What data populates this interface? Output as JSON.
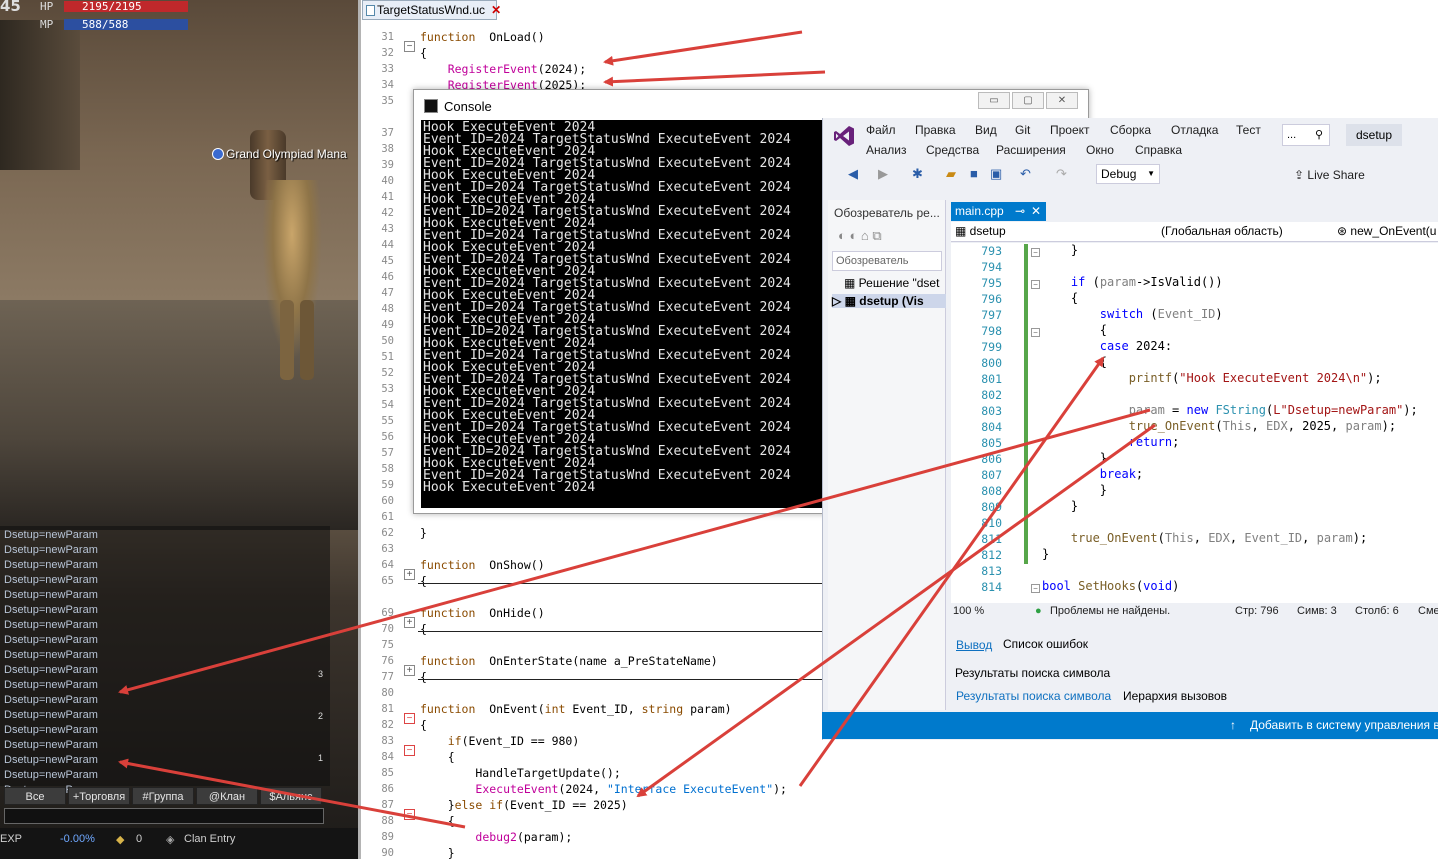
{
  "game": {
    "level": "45",
    "hp": {
      "label": "HP",
      "value": "2195/2195",
      "fill": 1.0,
      "color": "#c0282b"
    },
    "mp": {
      "label": "MP",
      "value": "588/588",
      "fill": 1.0,
      "color": "#2c4fa0"
    },
    "npc_label": "Grand Olympiad Mana",
    "chat_lines": [
      "Dsetup=newParam",
      "Dsetup=newParam",
      "Dsetup=newParam",
      "Dsetup=newParam",
      "Dsetup=newParam",
      "Dsetup=newParam",
      "Dsetup=newParam",
      "Dsetup=newParam",
      "Dsetup=newParam",
      "Dsetup=newParam",
      "Dsetup=newParam",
      "Dsetup=newParam",
      "Dsetup=newParam",
      "Dsetup=newParam",
      "Dsetup=newParam",
      "Dsetup=newParam",
      "Dsetup=newParam",
      "Dsetup=newParam"
    ],
    "chat_scroll": [
      "3",
      "2",
      "1"
    ],
    "chat_tabs": [
      "Все",
      "+Торговля",
      "#Группа",
      "@Клан",
      "$Альянс"
    ],
    "status": {
      "exp_label": "EXP",
      "exp_value": "-0.00%",
      "adena": "0",
      "clan": "Clan Entry"
    }
  },
  "editor": {
    "tab": "TargetStatusWnd.uc",
    "lines": [
      {
        "n": "31",
        "code": [
          [
            "kw",
            "function"
          ],
          [
            "",
            "  OnLoad()"
          ]
        ]
      },
      {
        "n": "32",
        "code": [
          [
            "",
            "{"
          ]
        ]
      },
      {
        "n": "33",
        "code": [
          [
            "",
            "    "
          ],
          [
            "pk",
            "RegisterEvent"
          ],
          [
            "",
            "(2024);"
          ]
        ]
      },
      {
        "n": "34",
        "code": [
          [
            "",
            "    "
          ],
          [
            "pk",
            "RegisterEvent"
          ],
          [
            "",
            "(2025);"
          ]
        ]
      },
      {
        "n": "35",
        "code": []
      },
      {
        "n": "37",
        "code": []
      },
      {
        "n": "38",
        "code": []
      },
      {
        "n": "39",
        "code": []
      },
      {
        "n": "40",
        "code": []
      },
      {
        "n": "41",
        "code": []
      },
      {
        "n": "42",
        "code": []
      },
      {
        "n": "43",
        "code": []
      },
      {
        "n": "44",
        "code": []
      },
      {
        "n": "45",
        "code": []
      },
      {
        "n": "46",
        "code": []
      },
      {
        "n": "47",
        "code": []
      },
      {
        "n": "48",
        "code": []
      },
      {
        "n": "49",
        "code": []
      },
      {
        "n": "50",
        "code": []
      },
      {
        "n": "51",
        "code": []
      },
      {
        "n": "52",
        "code": []
      },
      {
        "n": "53",
        "code": []
      },
      {
        "n": "54",
        "code": []
      },
      {
        "n": "55",
        "code": []
      },
      {
        "n": "56",
        "code": []
      },
      {
        "n": "57",
        "code": []
      },
      {
        "n": "58",
        "code": []
      },
      {
        "n": "59",
        "code": []
      },
      {
        "n": "60",
        "code": []
      },
      {
        "n": "61",
        "code": []
      },
      {
        "n": "62",
        "code": [
          [
            "",
            "}"
          ]
        ]
      },
      {
        "n": "63",
        "code": []
      },
      {
        "n": "64",
        "code": [
          [
            "kw",
            "function"
          ],
          [
            "",
            "  OnShow()"
          ]
        ]
      },
      {
        "n": "65",
        "code": [
          [
            "",
            "{"
          ]
        ]
      },
      {
        "n": "69",
        "code": [
          [
            "kw",
            "function"
          ],
          [
            "",
            "  OnHide()"
          ]
        ]
      },
      {
        "n": "70",
        "code": [
          [
            "",
            "{"
          ]
        ]
      },
      {
        "n": "75",
        "code": []
      },
      {
        "n": "76",
        "code": [
          [
            "kw",
            "function"
          ],
          [
            "",
            "  OnEnterState(name a_PreStateName)"
          ]
        ]
      },
      {
        "n": "77",
        "code": [
          [
            "",
            "{"
          ]
        ]
      },
      {
        "n": "80",
        "code": []
      },
      {
        "n": "81",
        "code": [
          [
            "kw",
            "function"
          ],
          [
            "",
            "  OnEvent("
          ],
          [
            "kw",
            "int"
          ],
          [
            "",
            " Event_ID, "
          ],
          [
            "kw",
            "string"
          ],
          [
            "",
            " param)"
          ]
        ]
      },
      {
        "n": "82",
        "code": [
          [
            "",
            "{"
          ]
        ]
      },
      {
        "n": "83",
        "code": [
          [
            "",
            "    "
          ],
          [
            "kw",
            "if"
          ],
          [
            "",
            "(Event_ID == 980)"
          ]
        ]
      },
      {
        "n": "84",
        "code": [
          [
            "",
            "    {"
          ]
        ]
      },
      {
        "n": "85",
        "code": [
          [
            "",
            "        HandleTargetUpdate();"
          ]
        ]
      },
      {
        "n": "86",
        "code": [
          [
            "",
            "        "
          ],
          [
            "pk",
            "ExecuteEvent"
          ],
          [
            "",
            "(2024, "
          ],
          [
            "str",
            "\"Interface ExecuteEvent\""
          ],
          [
            "",
            ");"
          ]
        ]
      },
      {
        "n": "87",
        "code": [
          [
            "",
            "    }"
          ],
          [
            "kw",
            "else if"
          ],
          [
            "",
            "(Event_ID == 2025)"
          ]
        ]
      },
      {
        "n": "88",
        "code": [
          [
            "",
            "    {"
          ]
        ]
      },
      {
        "n": "89",
        "code": [
          [
            "",
            "        "
          ],
          [
            "pk",
            "debug2"
          ],
          [
            "",
            "(param);"
          ]
        ]
      },
      {
        "n": "90",
        "code": [
          [
            "",
            "    }"
          ]
        ]
      }
    ]
  },
  "console": {
    "title": "Console",
    "lines": [
      "Hook ExecuteEvent 2024",
      "Event_ID=2024 TargetStatusWnd ExecuteEvent 2024",
      "Hook ExecuteEvent 2024",
      "Event_ID=2024 TargetStatusWnd ExecuteEvent 2024",
      "Hook ExecuteEvent 2024",
      "Event_ID=2024 TargetStatusWnd ExecuteEvent 2024",
      "Hook ExecuteEvent 2024",
      "Event_ID=2024 TargetStatusWnd ExecuteEvent 2024",
      "Hook ExecuteEvent 2024",
      "Event_ID=2024 TargetStatusWnd ExecuteEvent 2024",
      "Hook ExecuteEvent 2024",
      "Event_ID=2024 TargetStatusWnd ExecuteEvent 2024",
      "Hook ExecuteEvent 2024",
      "Event_ID=2024 TargetStatusWnd ExecuteEvent 2024",
      "Hook ExecuteEvent 2024",
      "Event_ID=2024 TargetStatusWnd ExecuteEvent 2024",
      "Hook ExecuteEvent 2024",
      "Event_ID=2024 TargetStatusWnd ExecuteEvent 2024",
      "Hook ExecuteEvent 2024",
      "Event_ID=2024 TargetStatusWnd ExecuteEvent 2024",
      "Hook ExecuteEvent 2024",
      "Event_ID=2024 TargetStatusWnd ExecuteEvent 2024",
      "Hook ExecuteEvent 2024",
      "Event_ID=2024 TargetStatusWnd ExecuteEvent 2024",
      "Hook ExecuteEvent 2024",
      "Event_ID=2024 TargetStatusWnd ExecuteEvent 2024",
      "Hook ExecuteEvent 2024",
      "Event_ID=2024 TargetStatusWnd ExecuteEvent 2024",
      "Hook ExecuteEvent 2024",
      "Event_ID=2024 TargetStatusWnd ExecuteEvent 2024",
      "Hook ExecuteEvent 2024"
    ]
  },
  "vs": {
    "menu_row1": [
      "Файл",
      "Правка",
      "Вид",
      "Git",
      "Проект",
      "Сборка",
      "Отладка",
      "Тест"
    ],
    "menu_row2": [
      "Анализ",
      "Средства",
      "Расширения",
      "Окно",
      "Справка"
    ],
    "search": "...",
    "solution_name": "dsetup",
    "config": "Debug",
    "live_share": "Live Share",
    "solution_panel": {
      "header": "Обозреватель ре...",
      "search": "Обозреватель",
      "item1": "Решение \"dset",
      "item2": "dsetup (Vis"
    },
    "file_tab": "main.cpp",
    "nav": {
      "project": "dsetup",
      "scope": "(Глобальная область)",
      "member": "new_OnEvent(u"
    },
    "code": [
      {
        "n": "793",
        "t": [
          [
            "",
            "    }"
          ]
        ]
      },
      {
        "n": "794",
        "t": []
      },
      {
        "n": "795",
        "t": [
          [
            "",
            "    "
          ],
          [
            "vk",
            "if"
          ],
          [
            "",
            " ("
          ],
          [
            "vp",
            "param"
          ],
          [
            "",
            "->IsValid())"
          ]
        ]
      },
      {
        "n": "796",
        "t": [
          [
            "",
            "    {"
          ]
        ]
      },
      {
        "n": "797",
        "t": [
          [
            "",
            "        "
          ],
          [
            "vk",
            "switch"
          ],
          [
            "",
            " ("
          ],
          [
            "vp",
            "Event_ID"
          ],
          [
            "",
            ")"
          ]
        ]
      },
      {
        "n": "798",
        "t": [
          [
            "",
            "        {"
          ]
        ]
      },
      {
        "n": "799",
        "t": [
          [
            "",
            "        "
          ],
          [
            "vk",
            "case"
          ],
          [
            "",
            " 2024:"
          ]
        ]
      },
      {
        "n": "800",
        "t": [
          [
            "",
            "        {"
          ]
        ]
      },
      {
        "n": "801",
        "t": [
          [
            "",
            "            "
          ],
          [
            "vf",
            "printf"
          ],
          [
            "",
            "("
          ],
          [
            "vs",
            "\"Hook ExecuteEvent 2024\\n\""
          ],
          [
            "",
            ");"
          ]
        ]
      },
      {
        "n": "802",
        "t": []
      },
      {
        "n": "803",
        "t": [
          [
            "",
            "            "
          ],
          [
            "vp",
            "param"
          ],
          [
            "",
            " = "
          ],
          [
            "vk",
            "new"
          ],
          [
            "",
            " "
          ],
          [
            "vt",
            "FString"
          ],
          [
            "",
            "("
          ],
          [
            "vs",
            "L\"Dsetup=newParam\""
          ],
          [
            "",
            ");"
          ]
        ]
      },
      {
        "n": "804",
        "t": [
          [
            "",
            "            "
          ],
          [
            "vf",
            "true_OnEvent"
          ],
          [
            "",
            "("
          ],
          [
            "vp",
            "This"
          ],
          [
            "",
            ", "
          ],
          [
            "vp",
            "EDX"
          ],
          [
            "",
            ", 2025, "
          ],
          [
            "vp",
            "param"
          ],
          [
            "",
            ");"
          ]
        ]
      },
      {
        "n": "805",
        "t": [
          [
            "",
            "            "
          ],
          [
            "vk",
            "return"
          ],
          [
            "",
            ";"
          ]
        ]
      },
      {
        "n": "806",
        "t": [
          [
            "",
            "        }"
          ]
        ]
      },
      {
        "n": "807",
        "t": [
          [
            "",
            "        "
          ],
          [
            "vk",
            "break"
          ],
          [
            "",
            ";"
          ]
        ]
      },
      {
        "n": "808",
        "t": [
          [
            "",
            "        }"
          ]
        ]
      },
      {
        "n": "809",
        "t": [
          [
            "",
            "    }"
          ]
        ]
      },
      {
        "n": "810",
        "t": []
      },
      {
        "n": "811",
        "t": [
          [
            "",
            "    "
          ],
          [
            "vf",
            "true_OnEvent"
          ],
          [
            "",
            "("
          ],
          [
            "vp",
            "This"
          ],
          [
            "",
            ", "
          ],
          [
            "vp",
            "EDX"
          ],
          [
            "",
            ", "
          ],
          [
            "vp",
            "Event_ID"
          ],
          [
            "",
            ", "
          ],
          [
            "vp",
            "param"
          ],
          [
            "",
            ");"
          ]
        ]
      },
      {
        "n": "812",
        "t": [
          [
            "",
            "}"
          ]
        ]
      },
      {
        "n": "813",
        "t": []
      },
      {
        "n": "814",
        "t": [
          [
            "vk",
            "bool"
          ],
          [
            "",
            " "
          ],
          [
            "vf",
            "SetHooks"
          ],
          [
            "",
            "("
          ],
          [
            "vk",
            "void"
          ],
          [
            "",
            ")"
          ]
        ]
      }
    ],
    "status": {
      "zoom": "100 %",
      "problems": "Проблемы не найдены.",
      "line": "Стр: 796",
      "col": "Симв: 3",
      "pos": "Столб: 6",
      "end": "Сме"
    },
    "output_tabs": {
      "output": "Вывод",
      "errors": "Список ошибок",
      "find1": "Результаты поиска символа",
      "find2": "Результаты поиска символа",
      "hierarchy": "Иерархия вызовов"
    },
    "bottom_bar": "Добавить в систему управления в"
  },
  "colors": {
    "arrow": "#d9403a",
    "accent": "#007acc"
  }
}
